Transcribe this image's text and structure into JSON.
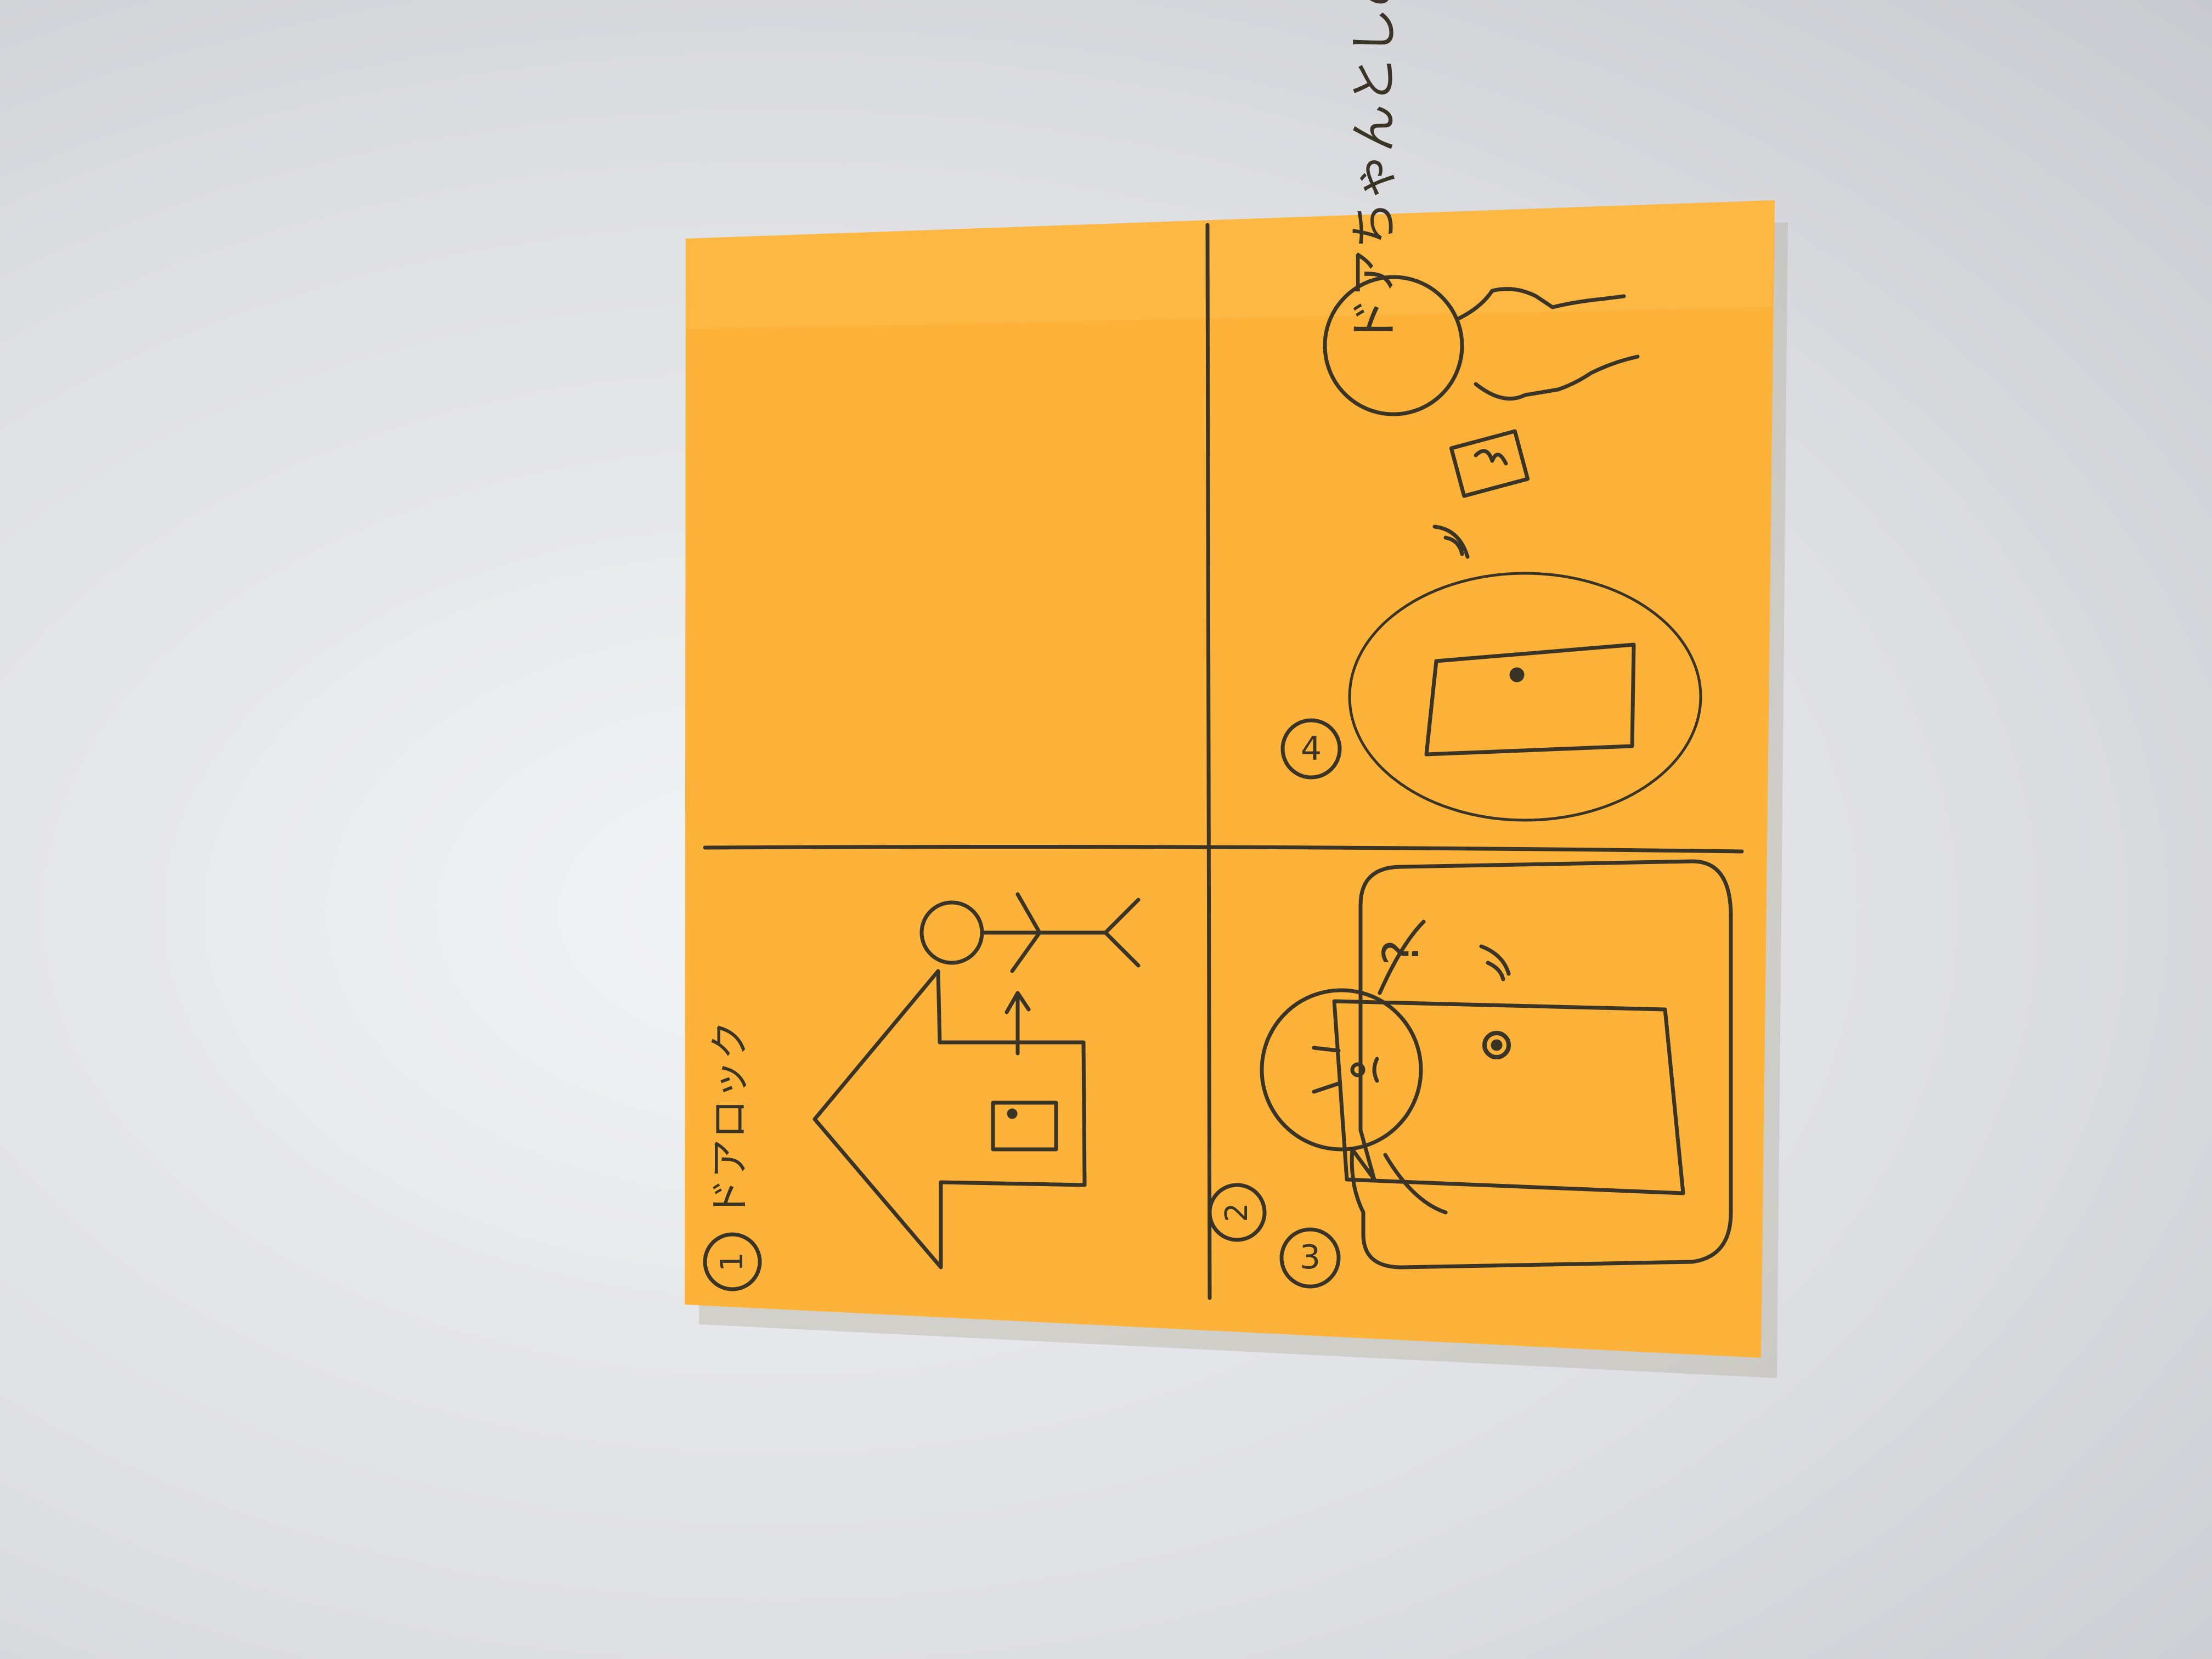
{
  "photo": {
    "subject": "sticky-note storyboard",
    "note_color": "#fdb23a",
    "background_color": "#e3e4e8",
    "ink_color": "#3a3426"
  },
  "panels": [
    {
      "number": "1",
      "caption": "ドアロック"
    },
    {
      "number": "2",
      "speech": "ドアちゃんとしめたっけ?",
      "mark": "?"
    },
    {
      "number": "3"
    },
    {
      "number": "4"
    }
  ]
}
